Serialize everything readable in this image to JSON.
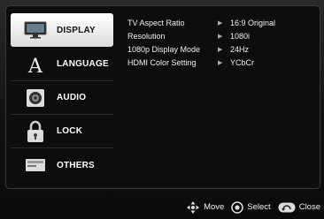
{
  "sidebar": {
    "items": [
      {
        "label": "DISPLAY",
        "icon": "display-icon",
        "selected": true
      },
      {
        "label": "LANGUAGE",
        "icon": "language-icon",
        "selected": false
      },
      {
        "label": "AUDIO",
        "icon": "audio-icon",
        "selected": false
      },
      {
        "label": "LOCK",
        "icon": "lock-icon",
        "selected": false
      },
      {
        "label": "OTHERS",
        "icon": "others-icon",
        "selected": false
      }
    ]
  },
  "settings": [
    {
      "name": "TV Aspect Ratio",
      "value": "16:9 Original"
    },
    {
      "name": "Resolution",
      "value": "1080i"
    },
    {
      "name": "1080p Display Mode",
      "value": "24Hz"
    },
    {
      "name": "HDMI Color Setting",
      "value": "YCbCr"
    }
  ],
  "footer": {
    "move_label": "Move",
    "select_label": "Select",
    "close_label": "Close"
  },
  "colors": {
    "selected_bg": "#ffffff",
    "panel_bg": "#0d0d0d",
    "text": "#ffffff"
  }
}
